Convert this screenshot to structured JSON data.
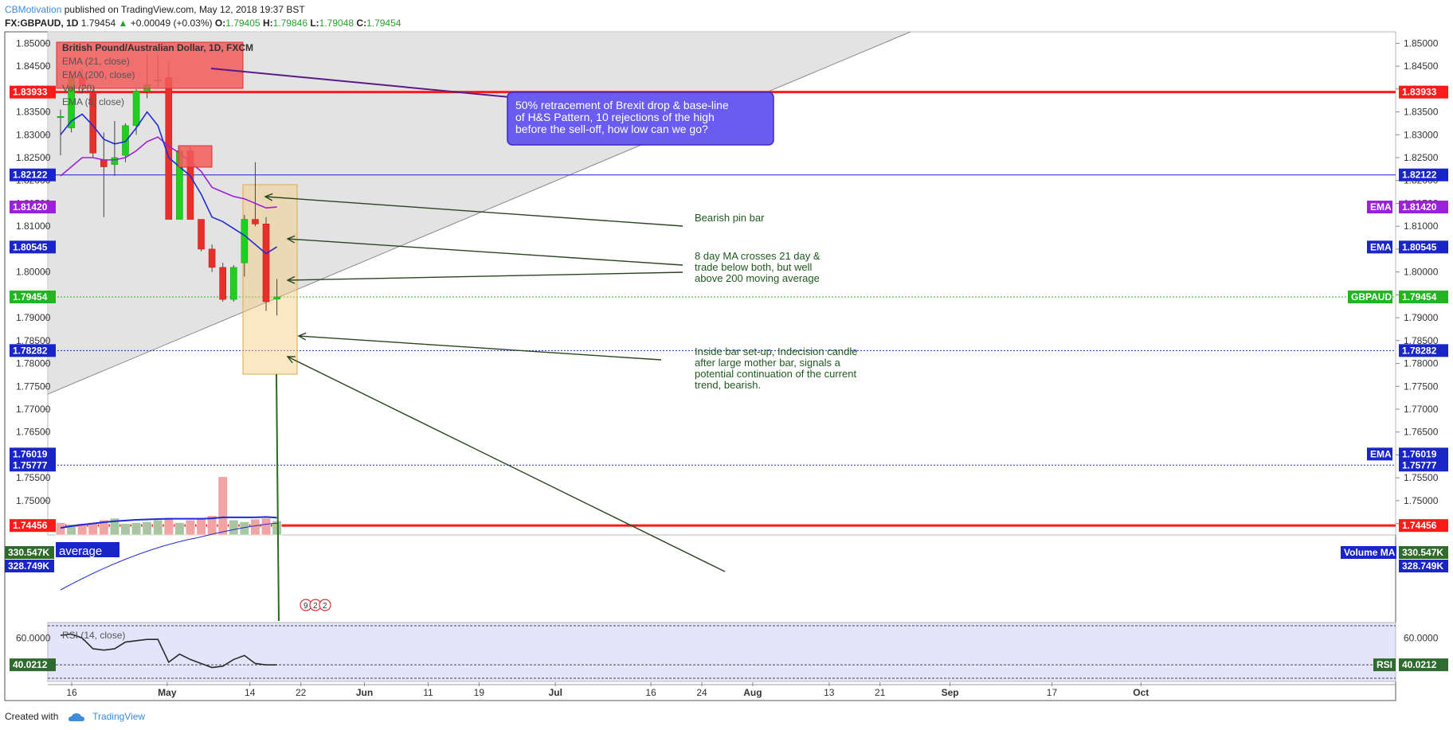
{
  "header": {
    "author": "CBMotivation",
    "published": "published on TradingView.com, May 12, 2018 19:37 BST",
    "symbol": "FX:GBPAUD, 1D",
    "last": "1.79454",
    "change": "+0.00049 (+0.03%)",
    "o_label": "O:",
    "o": "1.79405",
    "h_label": "H:",
    "h": "1.79846",
    "l_label": "L:",
    "l": "1.79048",
    "c_label": "C:",
    "c": "1.79454"
  },
  "footer": {
    "created_with": "Created with",
    "brand": "TradingView"
  },
  "colors": {
    "up": "#1fd01f",
    "down": "#e8302b",
    "ema21": "#1f2bd6",
    "ema8": "#9b20d9",
    "red_level": "#ff1a1a",
    "blue_level": "#1a25c8",
    "green_level": "#22b522",
    "annotation_text": "#1f5a1f",
    "callout_bg": "#6b5cf0",
    "vol_up": "#a7c6a1",
    "vol_down": "#f1a4a4"
  },
  "legend": [
    "British Pound/Australian Dollar, 1D, FXCM",
    "EMA (21, close)",
    "EMA (200, close)",
    "Vol (20)",
    "EMA (8, close)"
  ],
  "callout": [
    "50% retracement of Brexit drop & base-line",
    "of H&S Pattern, 10 rejections of the high",
    "before the sell-off, how low can we go?"
  ],
  "notes": {
    "pin": [
      "Bearish pin bar"
    ],
    "ma": [
      "8 day MA crosses 21 day &",
      "trade below both, but well",
      "above 200 moving average"
    ],
    "inside": [
      "Inside bar set-up, Indecision candle",
      "after large mother bar, signals a",
      "potential continuation of the current",
      "trend, bearish."
    ]
  },
  "average_label": "average",
  "rsi_label": "RSI (14, close)",
  "event_marks": [
    "9",
    "2",
    "2"
  ],
  "chart_data": {
    "type": "candlestick",
    "y_ticks": [
      "1.85000",
      "1.84500",
      "1.84000",
      "1.83500",
      "1.83000",
      "1.82500",
      "1.82000",
      "1.81500",
      "1.81000",
      "1.80500",
      "1.80000",
      "1.79500",
      "1.79000",
      "1.78500",
      "1.78000",
      "1.77500",
      "1.77000",
      "1.76500",
      "1.76000",
      "1.75500",
      "1.75000",
      "1.74500"
    ],
    "ylim": [
      1.7425,
      1.8525
    ],
    "x_labels": [
      {
        "label": "16",
        "date": "2018-04-16"
      },
      {
        "label": "May",
        "date": "2018-05-01"
      },
      {
        "label": "14",
        "date": "2018-05-14"
      },
      {
        "label": "22",
        "date": "2018-05-22"
      },
      {
        "label": "Jun",
        "date": "2018-06-01"
      },
      {
        "label": "11",
        "date": "2018-06-11"
      },
      {
        "label": "19",
        "date": "2018-06-19"
      },
      {
        "label": "Jul",
        "date": "2018-07-01"
      },
      {
        "label": "16",
        "date": "2018-07-16"
      },
      {
        "label": "24",
        "date": "2018-07-24"
      },
      {
        "label": "Aug",
        "date": "2018-08-01"
      },
      {
        "label": "13",
        "date": "2018-08-13"
      },
      {
        "label": "21",
        "date": "2018-08-21"
      },
      {
        "label": "Sep",
        "date": "2018-09-01"
      },
      {
        "label": "17",
        "date": "2018-09-17"
      },
      {
        "label": "Oct",
        "date": "2018-10-01"
      }
    ],
    "candles": [
      {
        "date": "2018-04-13",
        "o": 1.834,
        "h": 1.8355,
        "l": 1.8255,
        "c": 1.834
      },
      {
        "date": "2018-04-16",
        "o": 1.8315,
        "h": 1.844,
        "l": 1.8305,
        "c": 1.8425
      },
      {
        "date": "2018-04-17",
        "o": 1.8425,
        "h": 1.8445,
        "l": 1.839,
        "c": 1.841
      },
      {
        "date": "2018-04-18",
        "o": 1.839,
        "h": 1.84,
        "l": 1.825,
        "c": 1.826
      },
      {
        "date": "2018-04-19",
        "o": 1.8245,
        "h": 1.8305,
        "l": 1.812,
        "c": 1.823
      },
      {
        "date": "2018-04-20",
        "o": 1.8235,
        "h": 1.833,
        "l": 1.821,
        "c": 1.825
      },
      {
        "date": "2018-04-23",
        "o": 1.8255,
        "h": 1.8325,
        "l": 1.824,
        "c": 1.832
      },
      {
        "date": "2018-04-24",
        "o": 1.832,
        "h": 1.84,
        "l": 1.83,
        "c": 1.8395
      },
      {
        "date": "2018-04-25",
        "o": 1.8395,
        "h": 1.8475,
        "l": 1.838,
        "c": 1.841
      },
      {
        "date": "2018-04-26",
        "o": 1.842,
        "h": 1.8475,
        "l": 1.8405,
        "c": 1.842
      },
      {
        "date": "2018-04-27",
        "o": 1.8425,
        "h": 1.846,
        "l": 1.826,
        "c": 1.8115
      },
      {
        "date": "2018-04-30",
        "o": 1.8115,
        "h": 1.8275,
        "l": 1.8115,
        "c": 1.8265
      },
      {
        "date": "2018-05-01",
        "o": 1.8265,
        "h": 1.8275,
        "l": 1.8115,
        "c": 1.8115
      },
      {
        "date": "2018-05-02",
        "o": 1.8115,
        "h": 1.8115,
        "l": 1.8045,
        "c": 1.805
      },
      {
        "date": "2018-05-03",
        "o": 1.805,
        "h": 1.806,
        "l": 1.8,
        "c": 1.801
      },
      {
        "date": "2018-05-04",
        "o": 1.801,
        "h": 1.802,
        "l": 1.7935,
        "c": 1.794
      },
      {
        "date": "2018-05-07",
        "o": 1.794,
        "h": 1.8015,
        "l": 1.7935,
        "c": 1.801
      },
      {
        "date": "2018-05-08",
        "o": 1.802,
        "h": 1.8125,
        "l": 1.799,
        "c": 1.8115
      },
      {
        "date": "2018-05-09",
        "o": 1.8115,
        "h": 1.824,
        "l": 1.81,
        "c": 1.8105
      },
      {
        "date": "2018-05-10",
        "o": 1.8105,
        "h": 1.812,
        "l": 1.7915,
        "c": 1.7935
      },
      {
        "date": "2018-05-11",
        "o": 1.79405,
        "h": 1.79846,
        "l": 1.79048,
        "c": 1.79454
      }
    ],
    "ema8": [
      1.83,
      1.833,
      1.8345,
      1.832,
      1.829,
      1.828,
      1.8285,
      1.8315,
      1.835,
      1.832,
      1.825,
      1.823,
      1.821,
      1.817,
      1.812,
      1.811,
      1.8095,
      1.808,
      1.806,
      1.804,
      1.8055
    ],
    "ema21": [
      1.821,
      1.823,
      1.825,
      1.825,
      1.8245,
      1.8245,
      1.825,
      1.8265,
      1.8285,
      1.8295,
      1.8275,
      1.826,
      1.824,
      1.822,
      1.8185,
      1.8175,
      1.8165,
      1.816,
      1.815,
      1.814,
      1.8142
    ],
    "levels": [
      {
        "value": 1.83933,
        "label": "1.83933",
        "color": "#ff1a1a",
        "width": 3,
        "style": "solid"
      },
      {
        "value": 1.82122,
        "label": "1.82122",
        "color": "#1a25c8",
        "width": 1,
        "style": "solid"
      },
      {
        "value": 1.79454,
        "label": "1.79454",
        "color": "#22b522",
        "width": 1,
        "style": "dotted",
        "tag": "GBPAUD"
      },
      {
        "value": 1.78282,
        "label": "1.78282",
        "color": "#1a25c8",
        "width": 1,
        "style": "dotted"
      },
      {
        "value": 1.75777,
        "label": "1.75777",
        "color": "#1a25c8",
        "width": 1,
        "style": "dotted"
      },
      {
        "value": 1.74456,
        "label": "1.74456",
        "color": "#ff1a1a",
        "width": 3,
        "style": "solid"
      }
    ],
    "right_tags": [
      {
        "value": 1.8142,
        "label": "1.81420",
        "color": "#9b20d9",
        "tag": "EMA"
      },
      {
        "value": 1.80545,
        "label": "1.80545",
        "color": "#1a25c8",
        "tag": "EMA"
      },
      {
        "value": 1.76019,
        "label": "1.76019",
        "color": "#1a25c8",
        "tag": "EMA"
      },
      {
        "value": 1.75777,
        "label": "1.75777",
        "color": "#1a25c8",
        "tag": ""
      },
      {
        "value": 1.79454,
        "label": "1.79454",
        "color": "#22b522",
        "tag": "GBPAUD"
      },
      {
        "value": 1.83933,
        "label": "1.83933",
        "color": "#ff1a1a",
        "tag": ""
      },
      {
        "value": 1.82122,
        "label": "1.82122",
        "color": "#1a25c8",
        "tag": ""
      },
      {
        "value": 1.78282,
        "label": "1.78282",
        "color": "#1a25c8",
        "tag": ""
      },
      {
        "value": 1.74456,
        "label": "1.74456",
        "color": "#ff1a1a",
        "tag": ""
      }
    ],
    "left_tags": [
      {
        "value": 1.83933,
        "label": "1.83933",
        "color": "#ff1a1a"
      },
      {
        "value": 1.82122,
        "label": "1.82122",
        "color": "#1a25c8"
      },
      {
        "value": 1.8142,
        "label": "1.81420",
        "color": "#9b20d9"
      },
      {
        "value": 1.80545,
        "label": "1.80545",
        "color": "#1a25c8"
      },
      {
        "value": 1.79454,
        "label": "1.79454",
        "color": "#22b522"
      },
      {
        "value": 1.78282,
        "label": "1.78282",
        "color": "#1a25c8"
      },
      {
        "value": 1.76019,
        "label": "1.76019",
        "color": "#1a25c8"
      },
      {
        "value": 1.75777,
        "label": "1.75777",
        "color": "#1a25c8"
      },
      {
        "value": 1.74456,
        "label": "1.74456",
        "color": "#ff1a1a"
      }
    ],
    "volume": {
      "last": "330.547K",
      "ma": "328.749K",
      "ma_tag": "Volume MA",
      "values": [
        300,
        290,
        295,
        300,
        315,
        325,
        295,
        300,
        305,
        315,
        320,
        300,
        315,
        325,
        340,
        560,
        315,
        305,
        320,
        325,
        310
      ],
      "up": [
        false,
        true,
        false,
        false,
        false,
        true,
        true,
        true,
        true,
        true,
        false,
        true,
        false,
        false,
        false,
        false,
        true,
        true,
        false,
        false,
        true
      ],
      "ma_values": [
        270,
        280,
        288,
        295,
        302,
        308,
        312,
        316,
        318,
        320,
        322,
        322,
        322,
        322,
        324,
        330,
        330,
        330,
        330,
        332,
        328
      ],
      "ylim": [
        230,
        600
      ]
    },
    "rsi": {
      "label_value": "40.0212",
      "tag": "RSI",
      "y_tick": "60.0000",
      "values": [
        62,
        63,
        60,
        52,
        51,
        52,
        57,
        58,
        59,
        59,
        42,
        48,
        44,
        41,
        38,
        39,
        44,
        47,
        41,
        40,
        40
      ],
      "ylim": [
        30,
        68
      ],
      "band": [
        30,
        70
      ]
    }
  }
}
